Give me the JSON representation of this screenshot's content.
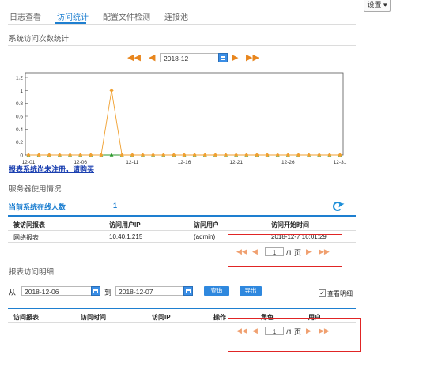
{
  "tabs": [
    {
      "label": "日志查看"
    },
    {
      "label": "访问统计"
    },
    {
      "label": "配置文件检测"
    },
    {
      "label": "连接池"
    }
  ],
  "settings_label": "设置",
  "stats_section": {
    "title": "系统访问次数统计",
    "date": "2018-12",
    "watermark": "报表系统尚未注册，请购买"
  },
  "chart_data": {
    "type": "line",
    "x": [
      "12-1",
      "12-2",
      "12-3",
      "12-4",
      "12-5",
      "12-6",
      "12-7",
      "12-8",
      "12-9",
      "12-10",
      "12-11",
      "12-12",
      "12-13",
      "12-14",
      "12-15",
      "12-16",
      "12-17",
      "12-18",
      "12-19",
      "12-20",
      "12-21",
      "12-22",
      "12-23",
      "12-24",
      "12-25",
      "12-26",
      "12-27",
      "12-28",
      "12-29",
      "12-30",
      "12-31"
    ],
    "xticks": [
      "12-01",
      "12-06",
      "12-11",
      "12-16",
      "12-21",
      "12-26",
      "12-31"
    ],
    "series": [
      {
        "values": [
          0,
          0,
          0,
          0,
          0,
          0,
          0,
          0,
          0,
          0,
          0,
          0,
          0,
          0,
          0,
          0,
          0,
          0,
          0,
          0,
          0,
          0,
          0,
          0,
          0,
          0,
          0,
          0,
          0,
          0,
          0
        ],
        "color": "#2e9a2e",
        "marker": "triangle"
      },
      {
        "values": [
          0,
          0,
          0,
          0,
          0,
          0,
          0,
          0,
          1,
          0,
          0,
          0,
          0,
          0,
          0,
          0,
          0,
          0,
          0,
          0,
          0,
          0,
          0,
          0,
          0,
          0,
          0,
          0,
          0,
          0,
          0
        ],
        "color": "#f0a030",
        "marker": "diamond"
      }
    ],
    "yticks": [
      "0",
      "0.2",
      "0.4",
      "0.6",
      "0.8",
      "1",
      "1.2"
    ],
    "ylim": [
      0,
      1.2
    ],
    "grid": false
  },
  "server_section": {
    "title": "服务器使用情况",
    "online_label": "当前系统在线人数",
    "online_count": "1",
    "columns": [
      "被访问报表",
      "访问用户IP",
      "访问用户",
      "访问开始时间"
    ],
    "rows": [
      [
        "网络报表",
        "10.40.1.215",
        "(admin)",
        "2018-12-7 16:01:29"
      ]
    ],
    "pager": {
      "page": "1",
      "total": "/1 页"
    }
  },
  "detail_section": {
    "title": "报表访问明细",
    "from_label": "从",
    "from_date": "2018-12-06",
    "to_label": "到",
    "to_date": "2018-12-07",
    "query_label": "查询",
    "export_label": "导出",
    "show_detail_label": "查看明细",
    "show_detail_checked": "✓",
    "columns": [
      "访问报表",
      "访问时间",
      "访问IP",
      "操作",
      "角色",
      "用户"
    ],
    "pager": {
      "page": "1",
      "total": "/1 页"
    }
  },
  "colors": {
    "accent": "#1e7fd0",
    "orange": "#e8861e",
    "highlight": "#e02525"
  }
}
